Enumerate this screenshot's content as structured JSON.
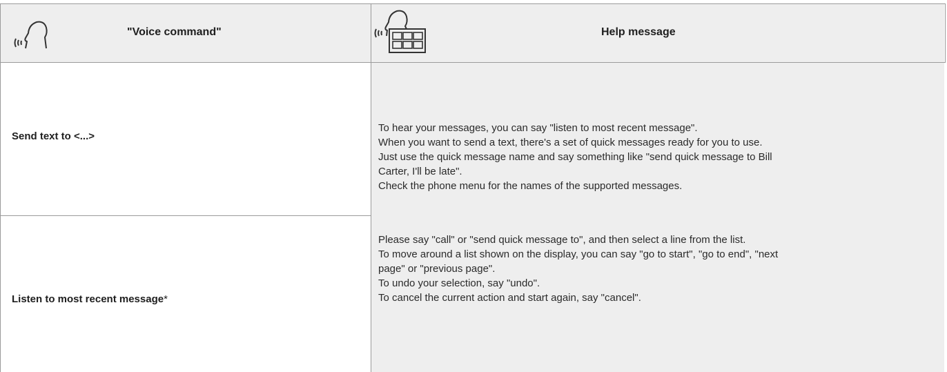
{
  "header": {
    "voice_command_title": "\"Voice command\"",
    "help_message_title": "Help message",
    "voice_icon": "speaking-head-icon",
    "help_icon": "speaking-head-keypad-icon"
  },
  "commands": [
    {
      "label": "Send text to <...>",
      "suffix": ""
    },
    {
      "label": "Listen to most recent message",
      "suffix": "*"
    }
  ],
  "help_blocks": [
    {
      "lines": [
        "To hear your messages, you can say \"listen to most recent message\".",
        "When you want to send a text, there's a set of quick messages ready for you to use.",
        "Just use the quick message name and say something like \"send quick message to Bill",
        "Carter, I'll be late\".",
        "Check the phone menu for the names of the supported messages."
      ]
    },
    {
      "lines": [
        "Please say \"call\" or \"send quick message to\", and then select a line from the list.",
        "To move around a list shown on the display, you can say \"go to start\", \"go to end\", \"next",
        "page\" or \"previous page\".",
        "To undo your selection, say \"undo\".",
        "To cancel the current action and start again, say \"cancel\"."
      ]
    }
  ],
  "colors": {
    "header_bg": "#eeeeee",
    "help_bg": "#eeeeee",
    "rule": "#9a9a9a"
  }
}
